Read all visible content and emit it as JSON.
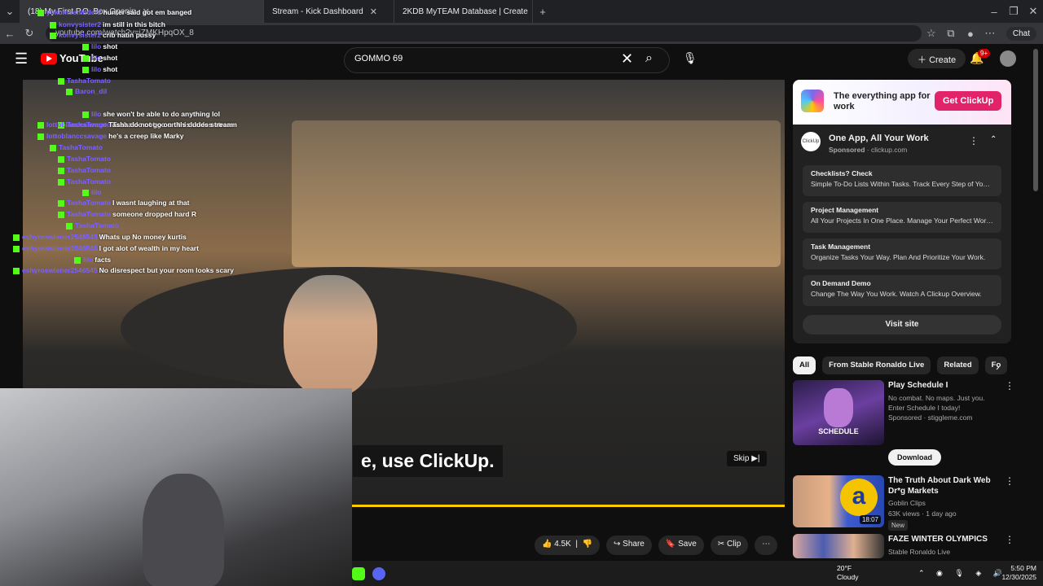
{
  "browser": {
    "tabs": [
      {
        "label": "(18) My First P.O. Box Openin",
        "active": true
      },
      {
        "label": "Stream - Kick Dashboard",
        "active": false
      },
      {
        "label": "2KDB MyTEAM Database | Create",
        "active": false
      }
    ],
    "url": "youtube.com/watch?v=iZMKHpqOX_8",
    "chat_button": "Chat"
  },
  "youtube": {
    "logo_text": "YouTube",
    "search_value": "GOMMO 69",
    "create_label": "Create",
    "notifications_badge": "9+"
  },
  "player": {
    "caption": "e, use ClickUp.",
    "skip_label": "Skip",
    "progress_fraction": 1.0,
    "progress_color": "#ffcc00"
  },
  "stream_chat": [
    {
      "user": "yokumsenidder2",
      "msg": "hunter said got em banged"
    },
    {
      "user": "konvysister2",
      "msg": "im still in this bitch"
    },
    {
      "user": "konvysister2",
      "msg": "crib hatin pussy"
    },
    {
      "user": "lilo",
      "msg": "shot"
    },
    {
      "user": "lilo",
      "msg": "shot"
    },
    {
      "user": "lilo",
      "msg": "shot"
    },
    {
      "user": "TashaTomato",
      "msg": ""
    },
    {
      "user": "Baron_dil",
      "msg": ""
    },
    {
      "user": "lilo",
      "msg": "she won't be able to do anything lol"
    },
    {
      "user": "TashaTomato",
      "msg": "Tasha do not go on this dudes stream"
    },
    {
      "user": "lottoblanccsavage",
      "msg": "Tasha do not go on this dudes stream"
    },
    {
      "user": "lottoblanccsavage",
      "msg": "he's a creep like Marky"
    },
    {
      "user": "TashaTomato",
      "msg": ""
    },
    {
      "user": "TashaTomato",
      "msg": ""
    },
    {
      "user": "TashaTomato",
      "msg": ""
    },
    {
      "user": "TashaTomato",
      "msg": ""
    },
    {
      "user": "lilo",
      "msg": ""
    },
    {
      "user": "TashaTomato",
      "msg": "I wasnt laughing at that"
    },
    {
      "user": "TashaTomato",
      "msg": "someone dropped hard R"
    },
    {
      "user": "TashaTomato",
      "msg": ""
    },
    {
      "user": "eshyroswiener2546545",
      "msg": "Whats up No money kurtis"
    },
    {
      "user": "eshyroswiener2546545",
      "msg": "I got alot of wealth in my heart"
    },
    {
      "user": "lilo",
      "msg": "facts"
    },
    {
      "user": "eshyroswiener2546545",
      "msg": "No disrespect but your room looks scary"
    }
  ],
  "actions": {
    "like_count": "4.5K",
    "share": "Share",
    "save": "Save",
    "clip": "Clip"
  },
  "ad": {
    "tagline": "The everything app for work",
    "cta": "Get ClickUp",
    "icon_text": "ClickUp",
    "title": "One App, All Your Work",
    "sponsored": "Sponsored",
    "domain": "clickup.com",
    "items": [
      {
        "title": "Checklists? Check",
        "desc": "Simple To-Do Lists Within Tasks. Track Every Step of Your Tas..."
      },
      {
        "title": "Project Management",
        "desc": "All Your Projects In One Place. Manage Your Perfect Workflow."
      },
      {
        "title": "Task Management",
        "desc": "Organize Tasks Your Way. Plan And Prioritize Your Work."
      },
      {
        "title": "On Demand Demo",
        "desc": "Change The Way You Work. Watch A Clickup Overview."
      }
    ],
    "visit": "Visit site"
  },
  "chips": [
    "All",
    "From Stable Ronaldo Live",
    "Related",
    "Fo"
  ],
  "recommendations": [
    {
      "title": "Play Schedule I",
      "line1": "No combat. No maps. Just you. Enter Schedule I today!",
      "line2": "Sponsored · stiggleme.com",
      "button": "Download",
      "thumb_text": "SCHEDULE"
    },
    {
      "title": "The Truth About Dark Web Dr*g Markets",
      "line1": "Goblin Clips",
      "line2": "63K views · 1 day ago",
      "badge": "New",
      "duration": "18:07"
    },
    {
      "title": "FAZE WINTER OLYMPICS",
      "line1": "Stable Ronaldo Live"
    }
  ],
  "taskbar": {
    "temp": "20°F",
    "condition": "Cloudy",
    "time": "5:50 PM",
    "date": "12/30/2025"
  }
}
